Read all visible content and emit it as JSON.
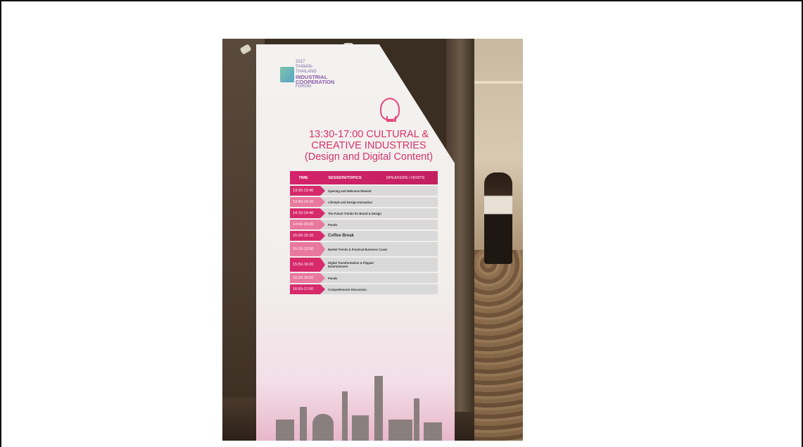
{
  "banner": {
    "logo": {
      "year": "2017",
      "line1": "TAIWAN-THAILAND",
      "line2": "INDUSTRIAL",
      "line3": "COOPERATION",
      "line4": "FORUM"
    },
    "headline_line1": "13:30-17:00 CULTURAL &",
    "headline_line2": "CREATIVE INDUSTRIES",
    "headline_line3": "(Design and Digital Content)",
    "headers": {
      "time": "TIME",
      "session": "SESSION/TOPICS",
      "speakers": "SPEAKERS / HOSTS"
    },
    "rows": [
      {
        "time": "13:30-13:40",
        "topic": "Opening and Welcome Remark",
        "light": false
      },
      {
        "time": "13:40-14:10",
        "topic": "Lifestyle and Design Innovation",
        "light": true
      },
      {
        "time": "14:10-14:40",
        "topic": "The Future Trends for Brand & Design",
        "light": false
      },
      {
        "time": "14:40-15:00",
        "topic": "Panels",
        "light": true
      },
      {
        "time": "15:00-15:10",
        "topic": "Coffee Break",
        "light": false
      },
      {
        "time": "15:10-15:50",
        "topic": "Market Trends & Practical Business Cases",
        "light": true
      },
      {
        "time": "15:50-16:20",
        "topic": "Digital Transformation & Flipped Entertainment",
        "light": false
      },
      {
        "time": "16:20-16:50",
        "topic": "Panels",
        "light": true
      },
      {
        "time": "16:50-17:00",
        "topic": "Comprehensive Discussion",
        "light": false
      }
    ]
  }
}
